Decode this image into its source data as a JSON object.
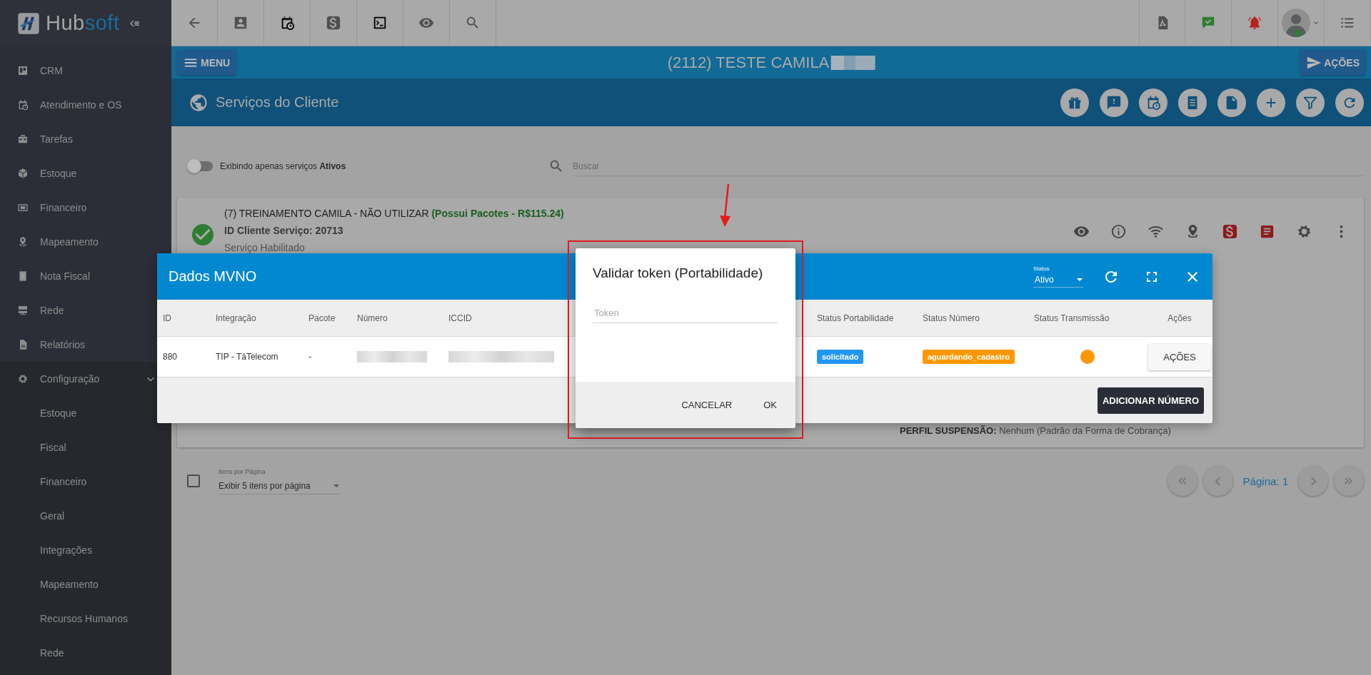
{
  "sidebar": {
    "logo": {
      "part_1": "Hub",
      "part_2": "soft"
    },
    "items": [
      {
        "label": "CRM"
      },
      {
        "label": "Atendimento e OS"
      },
      {
        "label": "Tarefas"
      },
      {
        "label": "Estoque"
      },
      {
        "label": "Financeiro"
      },
      {
        "label": "Mapeamento"
      },
      {
        "label": "Nota Fiscal"
      },
      {
        "label": "Rede"
      },
      {
        "label": "Relatórios"
      },
      {
        "label": "Configuração",
        "expanded": true,
        "children": [
          {
            "label": "Estoque"
          },
          {
            "label": "Fiscal"
          },
          {
            "label": "Financeiro"
          },
          {
            "label": "Geral"
          },
          {
            "label": "Integrações"
          },
          {
            "label": "Mapeamento"
          },
          {
            "label": "Recursos Humanos"
          },
          {
            "label": "Rede"
          }
        ]
      }
    ]
  },
  "header": {
    "menu_button": "MENU",
    "title": "(2112) TESTE CAMILA",
    "actions_button": "AÇÕES"
  },
  "section": {
    "title": "Serviços do Cliente"
  },
  "filter": {
    "toggle": {
      "label": "Exibindo apenas serviços **Ativos**",
      "on": false
    },
    "search": {
      "placeholder": "Buscar"
    }
  },
  "service": {
    "title": "(7) TREINAMENTO CAMILA - NÃO UTILIZAR",
    "package": "(Possui Pacotes - R$115.24)",
    "id_line": "ID Cliente Serviço: 20713",
    "status": "Serviço Habilitado",
    "profile_label": "PERFIL SUSPENSÃO:",
    "profile_value": "Nenhum (Padrão da Forma de Cobrança)"
  },
  "pagination": {
    "select_all": {
      "checked": false
    },
    "per_page": {
      "label": "Itens por Página",
      "value": "Exibir 5 itens por página"
    },
    "page": "Página: 1"
  },
  "mvno_modal": {
    "title": "Dados MVNO",
    "status_select": {
      "label": "Status",
      "value": "Ativo"
    },
    "columns": [
      "ID",
      "Integração",
      "Pacote",
      "Número",
      "ICCID",
      "Status Portabilidade",
      "Status Número",
      "Status Transmissão",
      "Ações"
    ],
    "rows": [
      {
        "id": "880",
        "integration": "TIP - TáTelecom",
        "package": "-",
        "portability": {
          "text": "solicitado",
          "color": "#2196f3"
        },
        "number_status": {
          "text": "aguardando_cadastro",
          "color": "#ff9800"
        },
        "transmission": {
          "color": "#ff9800"
        },
        "actions": "AÇÕES"
      }
    ],
    "add_button": "ADICIONAR NÚMERO"
  },
  "token_dialog": {
    "title": "Validar token (Portabilidade)",
    "token": {
      "placeholder": "Token"
    },
    "buttons": [
      "CANCELAR",
      "OK"
    ]
  }
}
